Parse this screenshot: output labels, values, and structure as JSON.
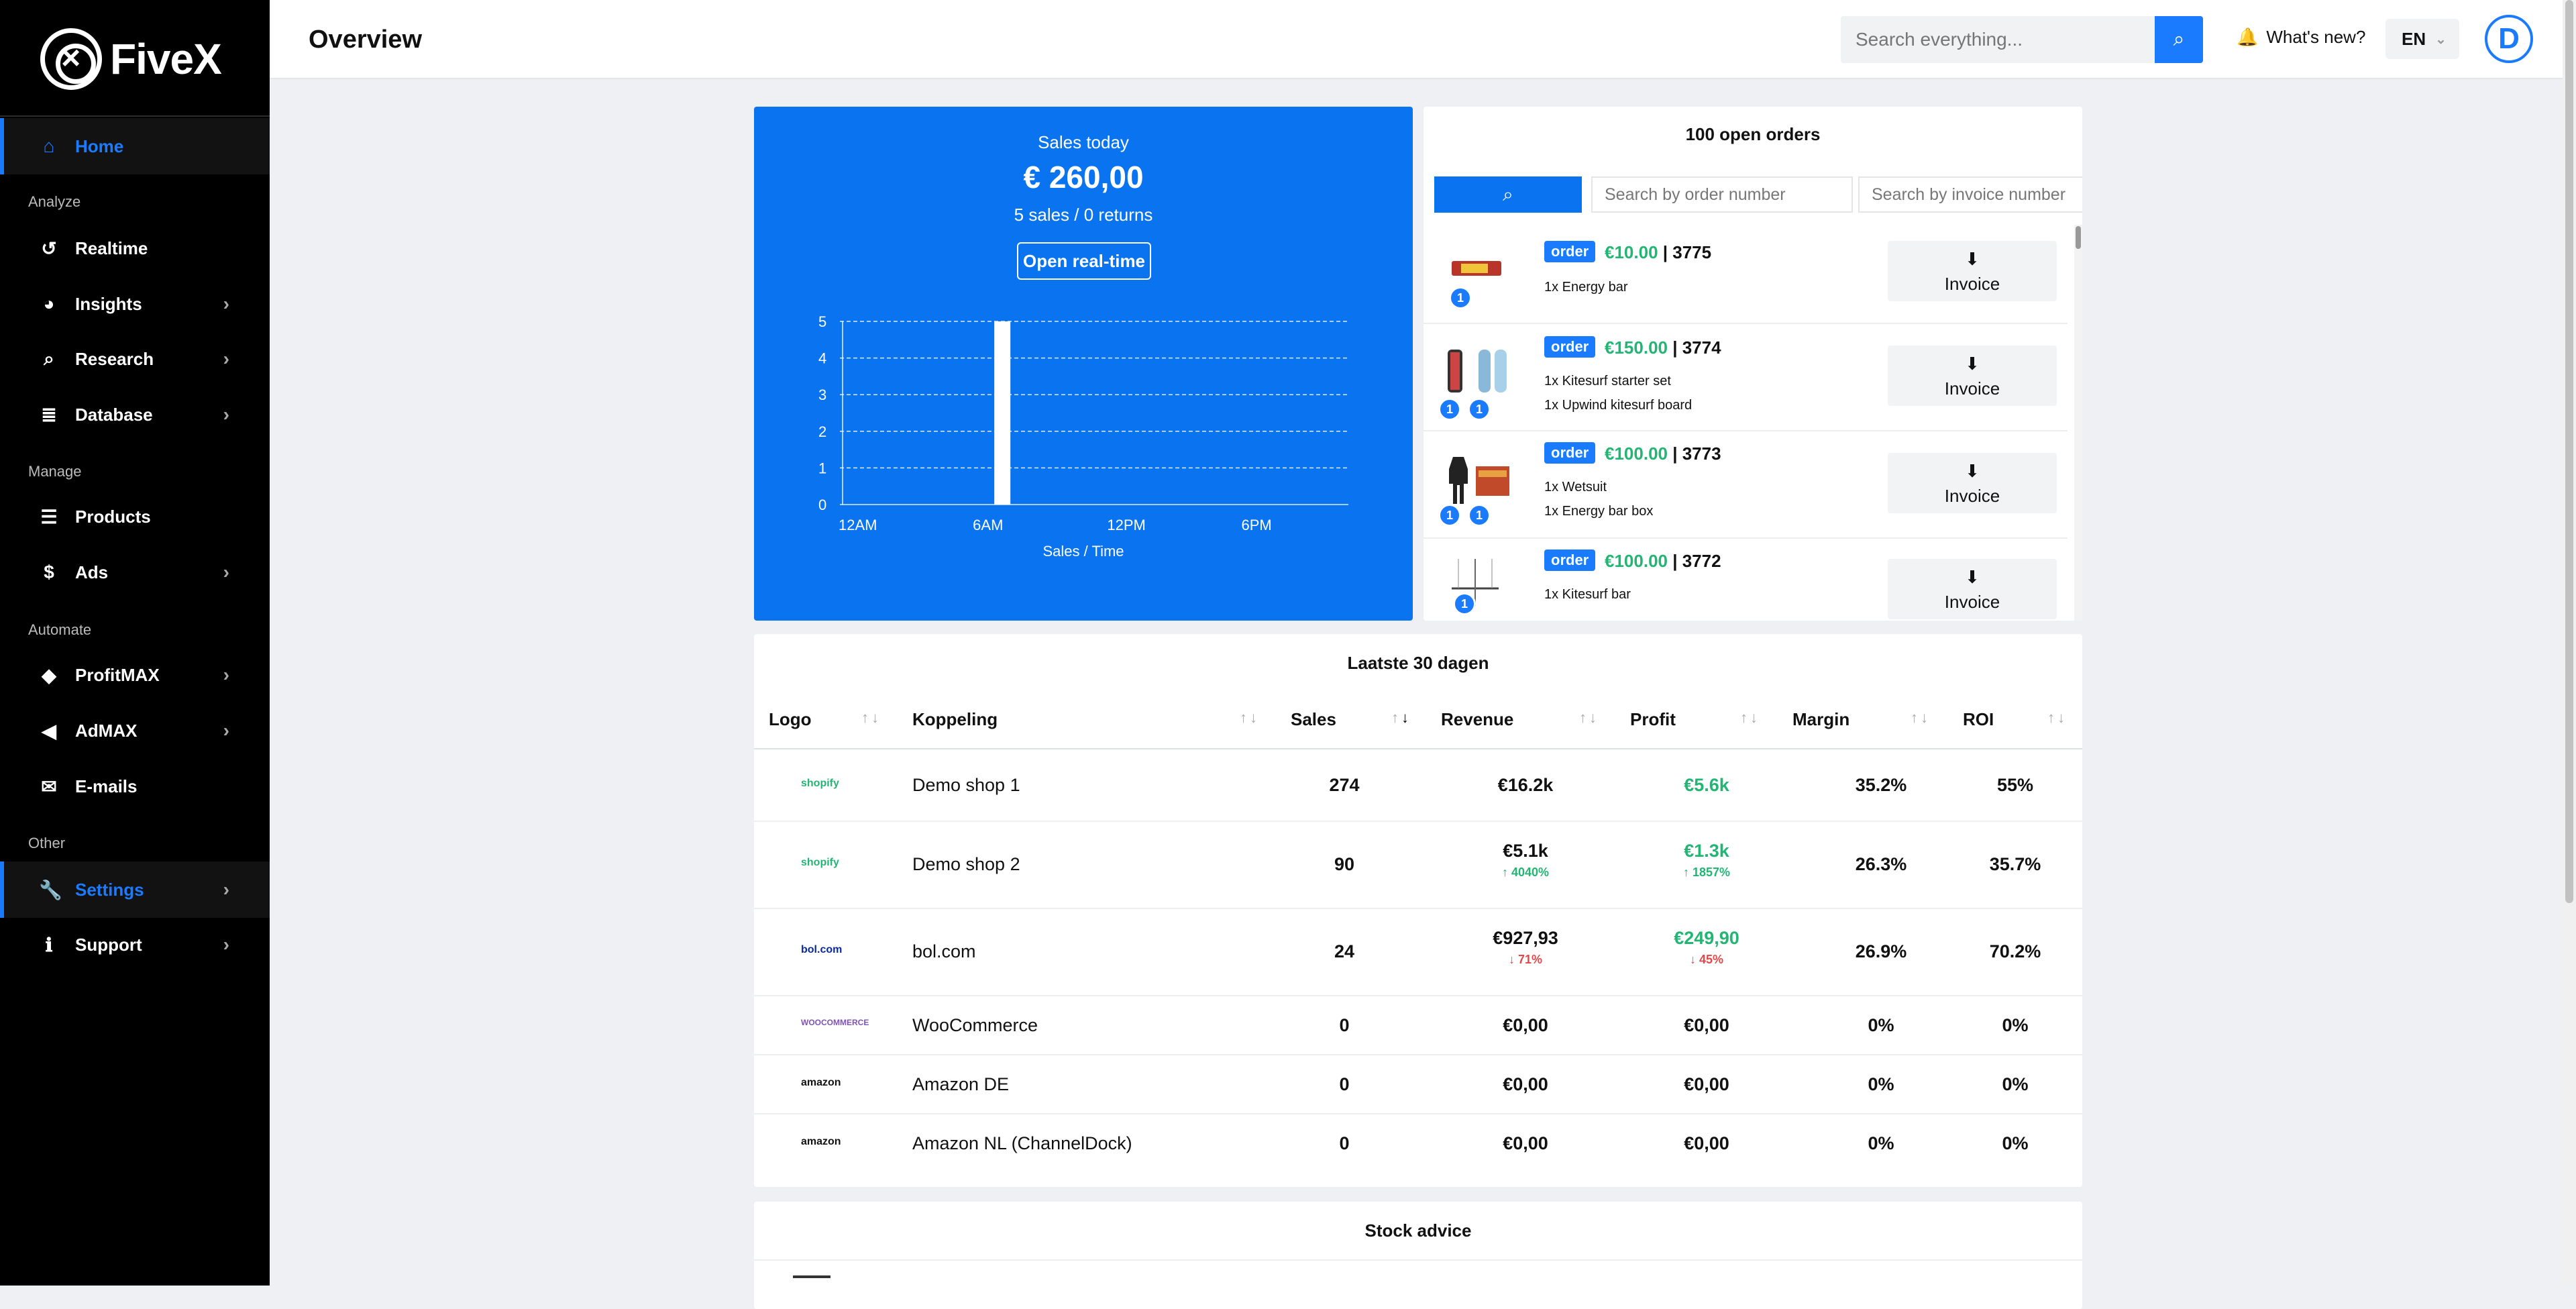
{
  "app": {
    "name": "FiveX"
  },
  "sidebar": {
    "sections": {
      "analyze": "Analyze",
      "manage": "Manage",
      "automate": "Automate",
      "other": "Other"
    },
    "items": [
      {
        "label": "Home",
        "icon": "home-icon"
      },
      {
        "label": "Realtime",
        "icon": "history-icon"
      },
      {
        "label": "Insights",
        "icon": "pie-chart-icon"
      },
      {
        "label": "Research",
        "icon": "search-icon"
      },
      {
        "label": "Database",
        "icon": "database-icon"
      },
      {
        "label": "Products",
        "icon": "list-icon"
      },
      {
        "label": "Ads",
        "icon": "dollar-icon"
      },
      {
        "label": "ProfitMAX",
        "icon": "tag-icon"
      },
      {
        "label": "AdMAX",
        "icon": "megaphone-icon"
      },
      {
        "label": "E-mails",
        "icon": "envelope-icon"
      },
      {
        "label": "Settings",
        "icon": "wrench-icon"
      },
      {
        "label": "Support",
        "icon": "info-icon"
      }
    ]
  },
  "header": {
    "title": "Overview",
    "search_placeholder": "Search everything...",
    "whats_new": "What's new?",
    "language": "EN",
    "avatar_letter": "D"
  },
  "sales_today": {
    "title": "Sales today",
    "amount": "€ 260,00",
    "summary": "5 sales / 0 returns",
    "button": "Open real-time",
    "x_label": "Sales / Time"
  },
  "chart_data": {
    "type": "bar",
    "x": [
      "12AM",
      "6AM",
      "12PM",
      "6PM"
    ],
    "xlabel": "Sales / Time",
    "ylabel": "",
    "ylim": [
      0,
      5
    ],
    "yticks": [
      0,
      1,
      2,
      3,
      4,
      5
    ],
    "series": [
      {
        "hour": 6,
        "value": 5
      }
    ]
  },
  "orders": {
    "title": "100 open orders",
    "search_order_placeholder": "Search by order number",
    "search_invoice_placeholder": "Search by invoice number",
    "tag": "order",
    "invoice_label": "Invoice",
    "list": [
      {
        "price": "€10.00",
        "number": "3775",
        "items": [
          "1x Energy bar"
        ],
        "badges": [
          "1"
        ]
      },
      {
        "price": "€150.00",
        "number": "3774",
        "items": [
          "1x Kitesurf starter set",
          "1x Upwind kitesurf board"
        ],
        "badges": [
          "1",
          "1"
        ]
      },
      {
        "price": "€100.00",
        "number": "3773",
        "items": [
          "1x Wetsuit",
          "1x Energy bar box"
        ],
        "badges": [
          "1",
          "1"
        ]
      },
      {
        "price": "€100.00",
        "number": "3772",
        "items": [
          "1x Kitesurf bar"
        ],
        "badges": [
          "1"
        ]
      }
    ]
  },
  "table": {
    "title": "Laatste 30 dagen",
    "columns": [
      "Logo",
      "Koppeling",
      "Sales",
      "Revenue",
      "Profit",
      "Margin",
      "ROI"
    ],
    "rows": [
      {
        "logo": "shopify",
        "name": "Demo shop 1",
        "sales": "274",
        "revenue": "€16.2k",
        "revenue_change": "",
        "profit": "€5.6k",
        "profit_change": "",
        "margin": "35.2%",
        "roi": "55%"
      },
      {
        "logo": "shopify",
        "name": "Demo shop 2",
        "sales": "90",
        "revenue": "€5.1k",
        "revenue_change": "4040%",
        "profit": "€1.3k",
        "profit_change": "1857%",
        "margin": "26.3%",
        "roi": "35.7%"
      },
      {
        "logo": "bol.com",
        "name": "bol.com",
        "sales": "24",
        "revenue": "€927,93",
        "revenue_change": "71%",
        "profit": "€249,90",
        "profit_change": "45%",
        "margin": "26.9%",
        "roi": "70.2%"
      },
      {
        "logo": "WOOCOMMERCE",
        "name": "WooCommerce",
        "sales": "0",
        "revenue": "€0,00",
        "revenue_change": "",
        "profit": "€0,00",
        "profit_change": "",
        "margin": "0%",
        "roi": "0%"
      },
      {
        "logo": "amazon",
        "name": "Amazon DE",
        "sales": "0",
        "revenue": "€0,00",
        "revenue_change": "",
        "profit": "€0,00",
        "profit_change": "",
        "margin": "0%",
        "roi": "0%"
      },
      {
        "logo": "amazon",
        "name": "Amazon NL (ChannelDock)",
        "sales": "0",
        "revenue": "€0,00",
        "revenue_change": "",
        "profit": "€0,00",
        "profit_change": "",
        "margin": "0%",
        "roi": "0%"
      }
    ]
  },
  "stock_advice": {
    "title": "Stock advice"
  },
  "colors": {
    "accent": "#1b7bff",
    "sales_panel": "#0a74f0",
    "positive": "#22b573",
    "negative": "#e04848"
  }
}
